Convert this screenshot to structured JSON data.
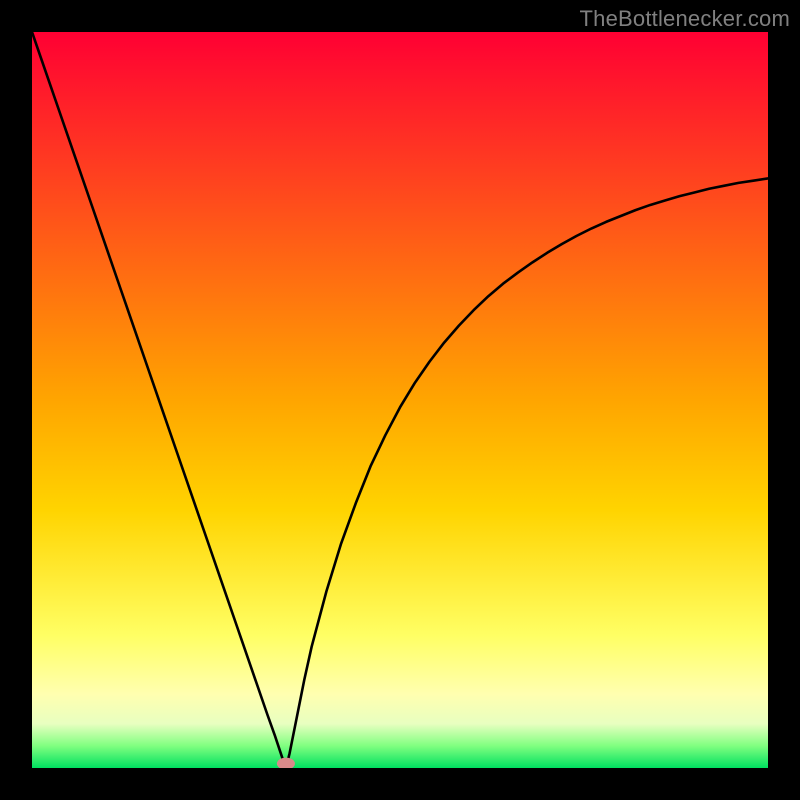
{
  "watermark": "TheBottlenecker.com",
  "chart_data": {
    "type": "line",
    "title": "",
    "xlabel": "",
    "ylabel": "",
    "xlim": [
      0,
      100
    ],
    "ylim": [
      0,
      100
    ],
    "grid": false,
    "x_grid_approx": 34,
    "gradient_bands": [
      {
        "y": 100,
        "color": "#ff0033"
      },
      {
        "y": 50,
        "color": "#ffa500"
      },
      {
        "y": 35,
        "color": "#ffd400"
      },
      {
        "y": 18,
        "color": "#ffff64"
      },
      {
        "y": 10,
        "color": "#ffffb0"
      },
      {
        "y": 6,
        "color": "#e8ffc0"
      },
      {
        "y": 3,
        "color": "#80ff80"
      },
      {
        "y": 0,
        "color": "#00e060"
      }
    ],
    "marker": {
      "x": 34.5,
      "y": 0.6,
      "color": "#d98a8a"
    },
    "series": [
      {
        "name": "curve",
        "x": [
          0,
          2,
          4,
          6,
          8,
          10,
          12,
          14,
          16,
          18,
          20,
          22,
          24,
          26,
          28,
          30,
          32,
          33,
          34,
          34.5,
          35,
          36,
          37,
          38,
          40,
          42,
          44,
          46,
          48,
          50,
          52,
          54,
          56,
          58,
          60,
          62,
          64,
          66,
          68,
          70,
          72,
          74,
          76,
          78,
          80,
          82,
          84,
          86,
          88,
          90,
          92,
          94,
          96,
          98,
          100
        ],
        "y": [
          100,
          94.2,
          88.4,
          82.6,
          76.8,
          71.0,
          65.2,
          59.4,
          53.6,
          47.8,
          42.0,
          36.2,
          30.4,
          24.6,
          18.8,
          13.0,
          7.2,
          4.4,
          1.4,
          0.0,
          2.0,
          7.0,
          12.0,
          16.5,
          24.0,
          30.5,
          36.0,
          41.0,
          45.2,
          49.0,
          52.3,
          55.2,
          57.8,
          60.1,
          62.2,
          64.1,
          65.8,
          67.3,
          68.7,
          70.0,
          71.2,
          72.3,
          73.3,
          74.2,
          75.0,
          75.8,
          76.5,
          77.1,
          77.7,
          78.2,
          78.7,
          79.1,
          79.5,
          79.8,
          80.1
        ]
      }
    ]
  }
}
